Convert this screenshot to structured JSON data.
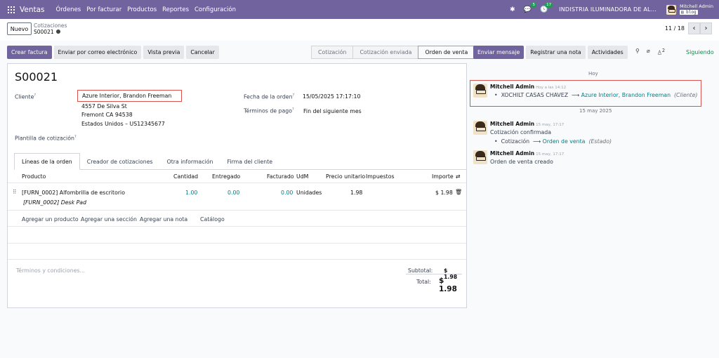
{
  "nav": {
    "app": "Ventas",
    "menu": [
      "Órdenes",
      "Por facturar",
      "Productos",
      "Reportes",
      "Configuración"
    ],
    "chat_count": "5",
    "activity_count": "17",
    "company": "INDISTRIA ILUMINADORA DE AL...",
    "user_name": "Mitchell Admin",
    "db": "blog"
  },
  "control": {
    "new_label": "Nuevo",
    "breadcrumb_parent": "Cotizaciones",
    "breadcrumb_current": "S00021",
    "pager": "11 / 18"
  },
  "actions": {
    "create_invoice": "Crear factura",
    "send_email": "Enviar por correo electrónico",
    "preview": "Vista previa",
    "cancel": "Cancelar",
    "stages": [
      "Cotización",
      "Cotización enviada",
      "Orden de venta"
    ]
  },
  "chatter_actions": {
    "send_message": "Enviar mensaje",
    "log_note": "Registrar una nota",
    "activities": "Actividades",
    "attach_count": "2",
    "follow": "Siguiendo"
  },
  "form": {
    "title": "S00021",
    "customer_label": "Cliente",
    "customer": "Azure Interior, Brandon Freeman",
    "address1": "4557 De Silva St",
    "address2": "Fremont CA 94538",
    "address3": "Estados Unidos – US12345677",
    "template_label": "Plantilla de cotización",
    "order_date_label": "Fecha de la orden",
    "order_date": "15/05/2025 17:17:10",
    "payment_terms_label": "Términos de pago",
    "payment_terms": "Fin del siguiente mes",
    "tabs": [
      "Líneas de la orden",
      "Creador de cotizaciones",
      "Otra información",
      "Firma del cliente"
    ],
    "columns": {
      "product": "Producto",
      "qty": "Cantidad",
      "delivered": "Entregado",
      "invoiced": "Facturado",
      "uom": "UdM",
      "price": "Precio unitario",
      "taxes": "Impuestos",
      "amount": "Importe"
    },
    "line": {
      "product": "[FURN_0002] Alfombrilla de escritorio",
      "description": "[FURN_0002] Desk Pad",
      "qty": "1.00",
      "delivered": "0.00",
      "invoiced": "0.00",
      "uom": "Unidades",
      "price": "1.98",
      "amount": "$ 1.98"
    },
    "add_links": [
      "Agregar un producto",
      "Agregar una sección",
      "Agregar una nota",
      "Catálogo"
    ],
    "terms_placeholder": "Términos y condiciones...",
    "subtotal_label": "Subtotal:",
    "subtotal": "$ 1.98",
    "total_label": "Total:",
    "total": "$ 1.98"
  },
  "chatter": {
    "today": "Hoy",
    "date_sep": "15 may 2025",
    "messages": [
      {
        "author": "Mitchell Admin",
        "time": "Hoy a las 14:12",
        "old": "XOCHILT CASAS CHAVEZ",
        "new": "Azure Interior, Brandon Freeman",
        "field": "(Cliente)"
      },
      {
        "author": "Mitchell Admin",
        "time": "15 may, 17:17",
        "text": "Cotización confirmada",
        "old": "Cotización",
        "new": "Orden de venta",
        "field": "(Estado)"
      },
      {
        "author": "Mitchell Admin",
        "time": "15 may, 17:17",
        "text": "Orden de venta creado"
      }
    ]
  }
}
